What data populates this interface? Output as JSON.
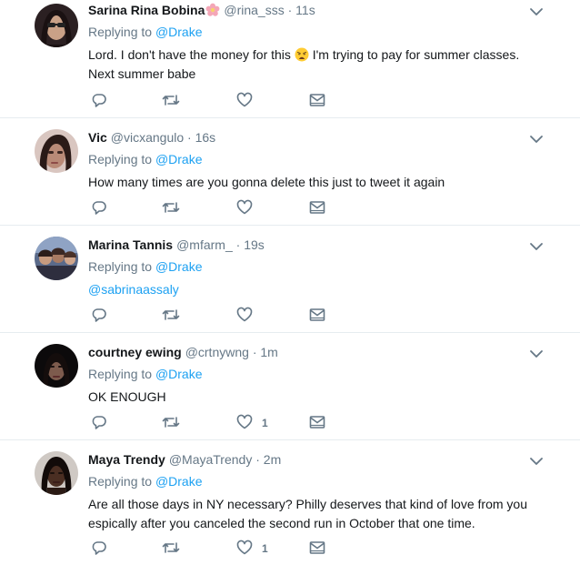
{
  "tweets": [
    {
      "name": "Sarina Rina Bobina",
      "handle": "@rina_sss",
      "time": "11s",
      "reply_prefix": "Replying to",
      "reply_to": "@Drake",
      "text_before_emoji": "Lord. I don't have the money for this ",
      "emoji": "weary-face",
      "text_after_emoji": " I'm trying to pay for summer classes. Next summer babe",
      "likes": ""
    },
    {
      "name": "Vic",
      "handle": "@vicxangulo",
      "time": "16s",
      "reply_prefix": "Replying to",
      "reply_to": "@Drake",
      "text": "How many times are you gonna delete this just to tweet it again",
      "likes": ""
    },
    {
      "name": "Marina Tannis",
      "handle": "@mfarm_",
      "time": "19s",
      "reply_prefix": "Replying to",
      "reply_to": "@Drake",
      "mention": "@sabrinaassaly",
      "likes": ""
    },
    {
      "name": "courtney ewing",
      "handle": "@crtnywng",
      "time": "1m",
      "reply_prefix": "Replying to",
      "reply_to": "@Drake",
      "text": "OK ENOUGH",
      "likes": "1"
    },
    {
      "name": "Maya Trendy",
      "handle": "@MayaTrendy",
      "time": "2m",
      "reply_prefix": "Replying to",
      "reply_to": "@Drake",
      "text": "Are all those days in NY necessary? Philly deserves that kind of love from you espically after you canceled the second run in October that one time.",
      "likes": "1"
    }
  ],
  "separator": "·",
  "icons": {
    "reply": "reply-icon",
    "retweet": "retweet-icon",
    "like": "heart-icon",
    "dm": "envelope-icon",
    "caret": "chevron-down-icon",
    "name_badge": "flower-icon"
  },
  "colors": {
    "text": "#14171a",
    "secondary": "#657786",
    "link": "#1da1f2",
    "divider": "#e6ecf0"
  }
}
